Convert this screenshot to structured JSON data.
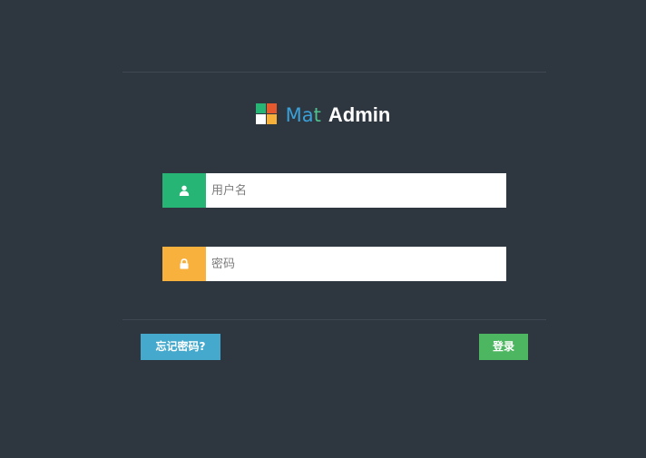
{
  "brand": {
    "prefix_ma": "Ma",
    "prefix_t": "t",
    "name": "Admin",
    "logo_colors": [
      "#27b575",
      "#e5592e",
      "#ffffff",
      "#f7b13b"
    ]
  },
  "login_form": {
    "username": {
      "placeholder": "用户名",
      "value": "",
      "icon": "user-icon",
      "icon_bg": "#27b575"
    },
    "password": {
      "placeholder": "密码",
      "value": "",
      "icon": "lock-icon",
      "icon_bg": "#f9b13e"
    }
  },
  "actions": {
    "forgot_label": "忘记密码?",
    "forgot_color": "#44a9cd",
    "login_label": "登录",
    "login_color": "#4db660"
  },
  "colors": {
    "background": "#2e3640",
    "divider": "#3f4852"
  }
}
